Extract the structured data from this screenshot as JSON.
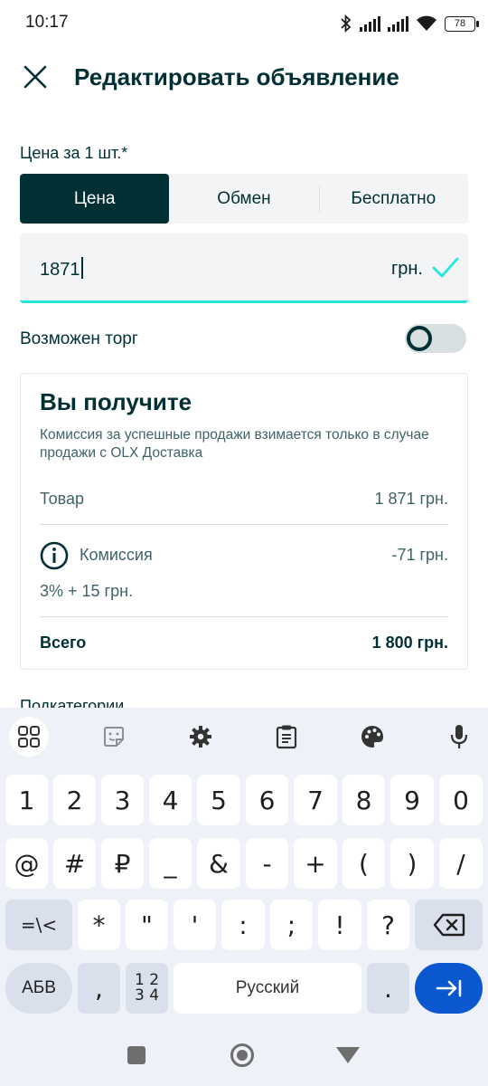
{
  "status_bar": {
    "time": "10:17",
    "battery": "78"
  },
  "header": {
    "title": "Редактировать объявление"
  },
  "price": {
    "label": "Цена за 1 шт.*",
    "tabs": [
      "Цена",
      "Обмен",
      "Бесплатно"
    ],
    "active_tab": "Цена",
    "value": "1871",
    "currency": "грн."
  },
  "negotiable": {
    "label": "Возможен торг",
    "enabled": false
  },
  "summary": {
    "title": "Вы получите",
    "description": "Комиссия за успешные продажи взимается только в случае продажи с OLX Доставка",
    "item_label": "Товар",
    "item_value": "1 871 грн.",
    "fee_label": "Комиссия",
    "fee_value": "-71 грн.",
    "fee_formula": "3% + 15 грн.",
    "total_label": "Всего",
    "total_value": "1 800 грн."
  },
  "subcategory_label": "Подкатегории",
  "keyboard": {
    "row1": [
      "1",
      "2",
      "3",
      "4",
      "5",
      "6",
      "7",
      "8",
      "9",
      "0"
    ],
    "row2": [
      "@",
      "#",
      "₽",
      "_",
      "&",
      "-",
      "+",
      "(",
      ")",
      "/"
    ],
    "row3": [
      "=\\<",
      "*",
      "\"",
      "'",
      ":",
      ";",
      "!",
      "?"
    ],
    "abc_label": "АБВ",
    "comma": ",",
    "numpad_top": "1 2",
    "numpad_bottom": "3 4",
    "space_label": "Русский",
    "period": "."
  },
  "colors": {
    "brand_dark": "#002f34",
    "accent_teal": "#23e5db",
    "enter_blue": "#0b57d0"
  }
}
